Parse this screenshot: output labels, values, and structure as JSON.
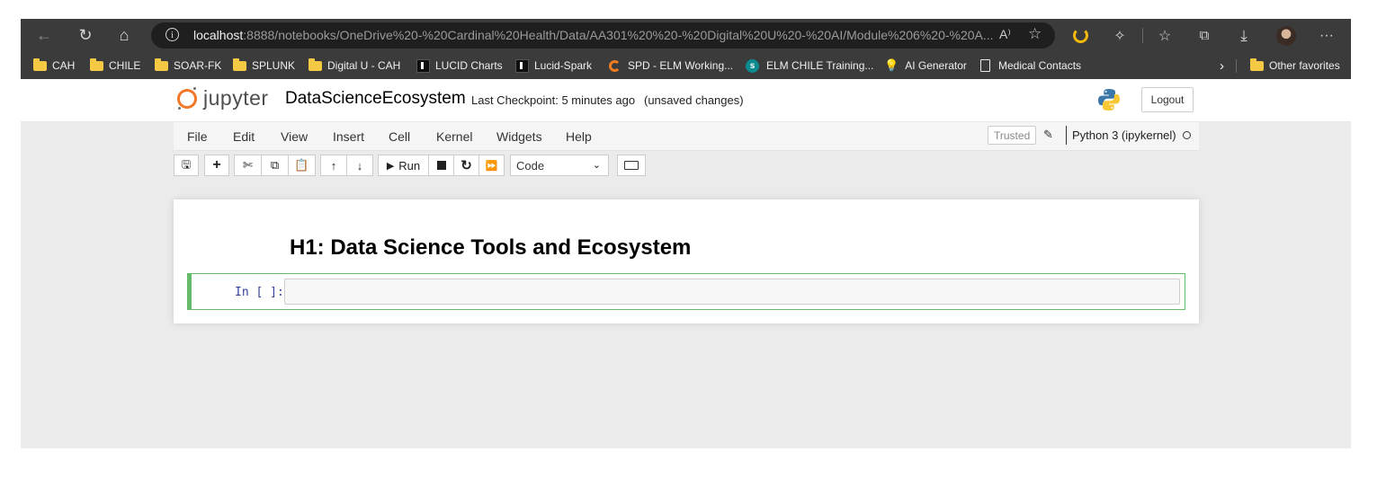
{
  "browser": {
    "nav": {
      "back_icon": "back-arrow-icon",
      "refresh_icon": "refresh-icon",
      "home_icon": "home-icon"
    },
    "url_host": "localhost",
    "url_path": ":8888/notebooks/OneDrive%20-%20Cardinal%20Health/Data/AA301%20%20-%20Digital%20U%20-%20AI/Module%206%20-%20A...",
    "read_aloud": "A⁾",
    "bookmarks": [
      {
        "label": "CAH",
        "icon": "folder"
      },
      {
        "label": "CHILE",
        "icon": "folder"
      },
      {
        "label": "SOAR-FK",
        "icon": "folder"
      },
      {
        "label": "SPLUNK",
        "icon": "folder"
      },
      {
        "label": "Digital U - CAH",
        "icon": "folder"
      },
      {
        "label": "LUCID Charts",
        "icon": "lucid"
      },
      {
        "label": "Lucid-Spark",
        "icon": "lucid"
      },
      {
        "label": "SPD - ELM Working...",
        "icon": "office"
      },
      {
        "label": "ELM CHILE Training...",
        "icon": "sharepoint"
      },
      {
        "label": "AI Generator",
        "icon": "bulb"
      },
      {
        "label": "Medical Contacts",
        "icon": "page"
      }
    ],
    "other_favorites": "Other favorites"
  },
  "jupyter": {
    "logo_text": "jupyter",
    "notebook_title": "DataScienceEcosystem",
    "checkpoint": "Last Checkpoint: 5 minutes ago",
    "unsaved": "(unsaved changes)",
    "logout": "Logout",
    "menus": [
      "File",
      "Edit",
      "View",
      "Insert",
      "Cell",
      "Kernel",
      "Widgets",
      "Help"
    ],
    "trusted": "Trusted",
    "kernel": "Python 3 (ipykernel)",
    "run_label": "Run",
    "cell_type": "Code"
  },
  "notebook": {
    "heading": "H1: Data Science Tools and Ecosystem",
    "prompt": "In [ ]:"
  },
  "colors": {
    "brand_orange": "#f37726",
    "cell_selected": "#66bb6a",
    "prompt_blue": "#303f9f"
  }
}
